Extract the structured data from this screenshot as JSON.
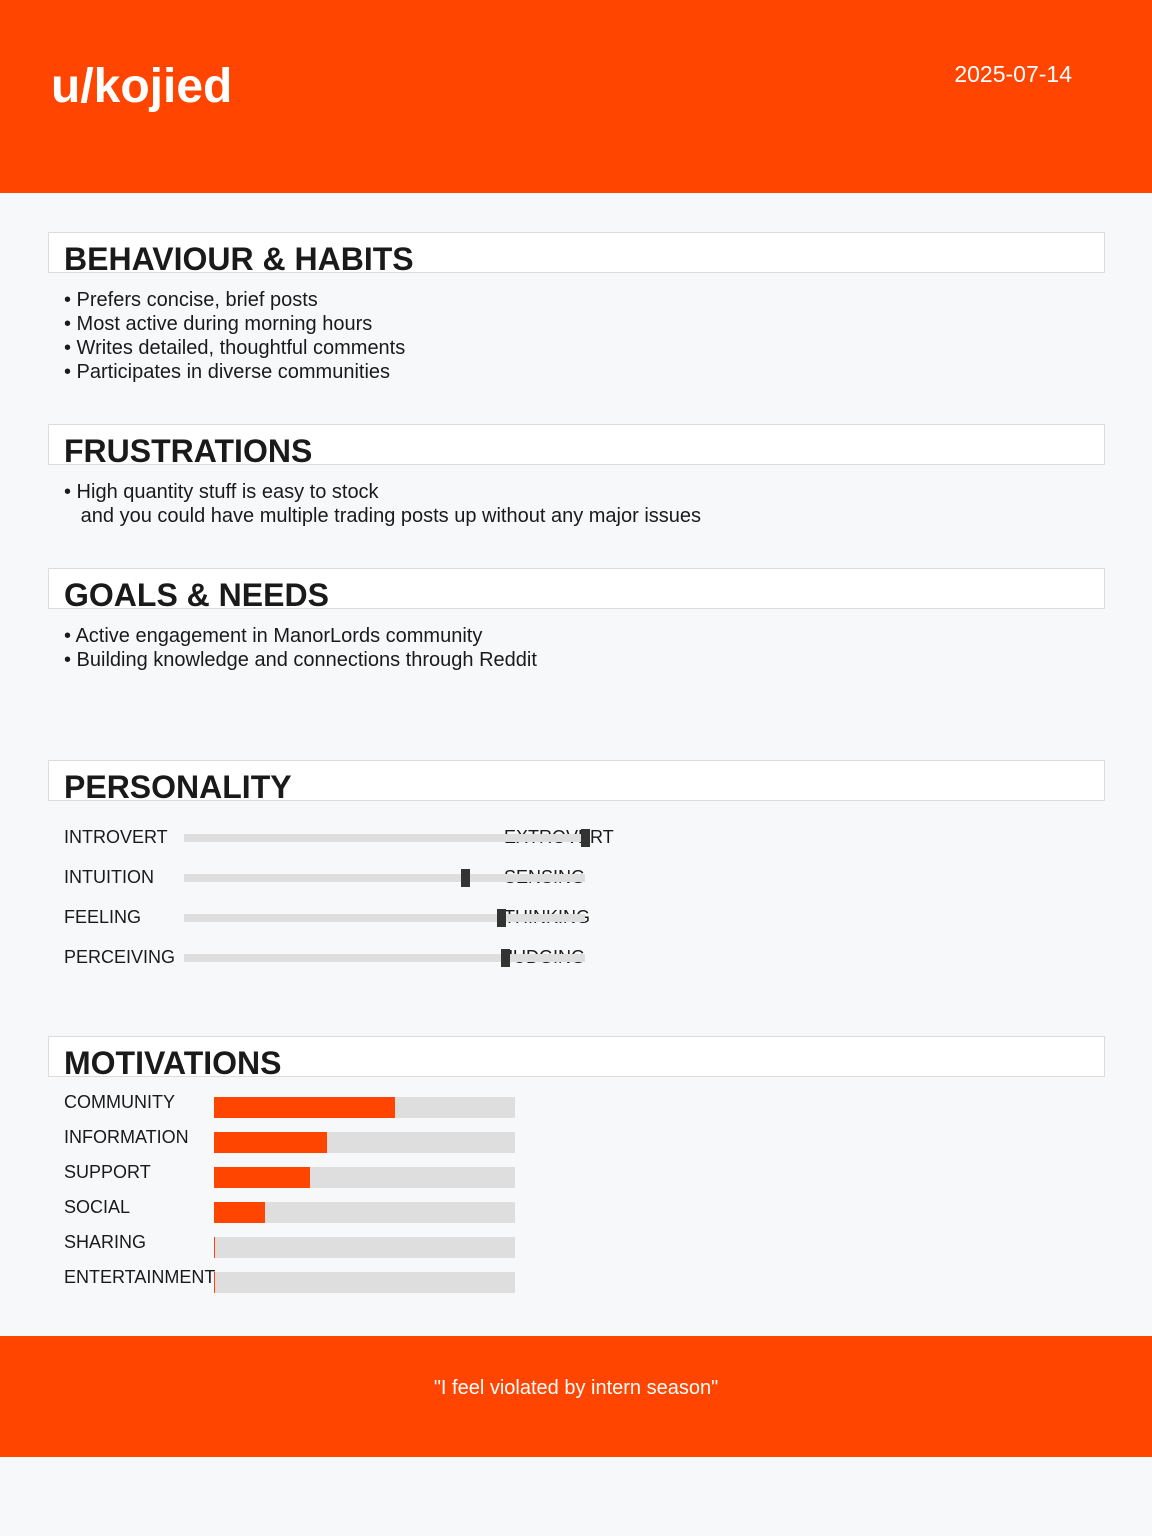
{
  "header": {
    "username": "u/kojied",
    "date": "2025-07-14",
    "color": "#ff4500"
  },
  "behaviour": {
    "title": "BEHAVIOUR & HABITS",
    "items": [
      "• Prefers concise, brief posts",
      "• Most active during morning hours",
      "• Writes detailed, thoughtful comments",
      "• Participates in diverse communities"
    ]
  },
  "frustrations": {
    "title": "FRUSTRATIONS",
    "items": [
      "• High quantity stuff is easy to stock",
      "   and you could have multiple trading posts up without any major issues"
    ]
  },
  "goals": {
    "title": "GOALS & NEEDS",
    "items": [
      "• Active engagement in ManorLords community",
      "• Building knowledge and connections through Reddit"
    ]
  },
  "personality": {
    "title": "PERSONALITY",
    "traits": [
      {
        "left": "INTROVERT",
        "right": "EXTROVERT",
        "value": 1.0
      },
      {
        "left": "INTUITION",
        "right": "SENSING",
        "value": 0.7
      },
      {
        "left": "FEELING",
        "right": "THINKING",
        "value": 0.79
      },
      {
        "left": "PERCEIVING",
        "right": "JUDGING",
        "value": 0.8
      }
    ]
  },
  "motivations": {
    "title": "MOTIVATIONS",
    "items": [
      {
        "label": "COMMUNITY",
        "value": 0.6
      },
      {
        "label": "INFORMATION",
        "value": 0.375
      },
      {
        "label": "SUPPORT",
        "value": 0.32
      },
      {
        "label": "SOCIAL",
        "value": 0.17
      },
      {
        "label": "SHARING",
        "value": 0.0
      },
      {
        "label": "ENTERTAINMENT",
        "value": 0.0
      }
    ]
  },
  "footer": {
    "quote": "\"I feel violated by intern season\""
  }
}
